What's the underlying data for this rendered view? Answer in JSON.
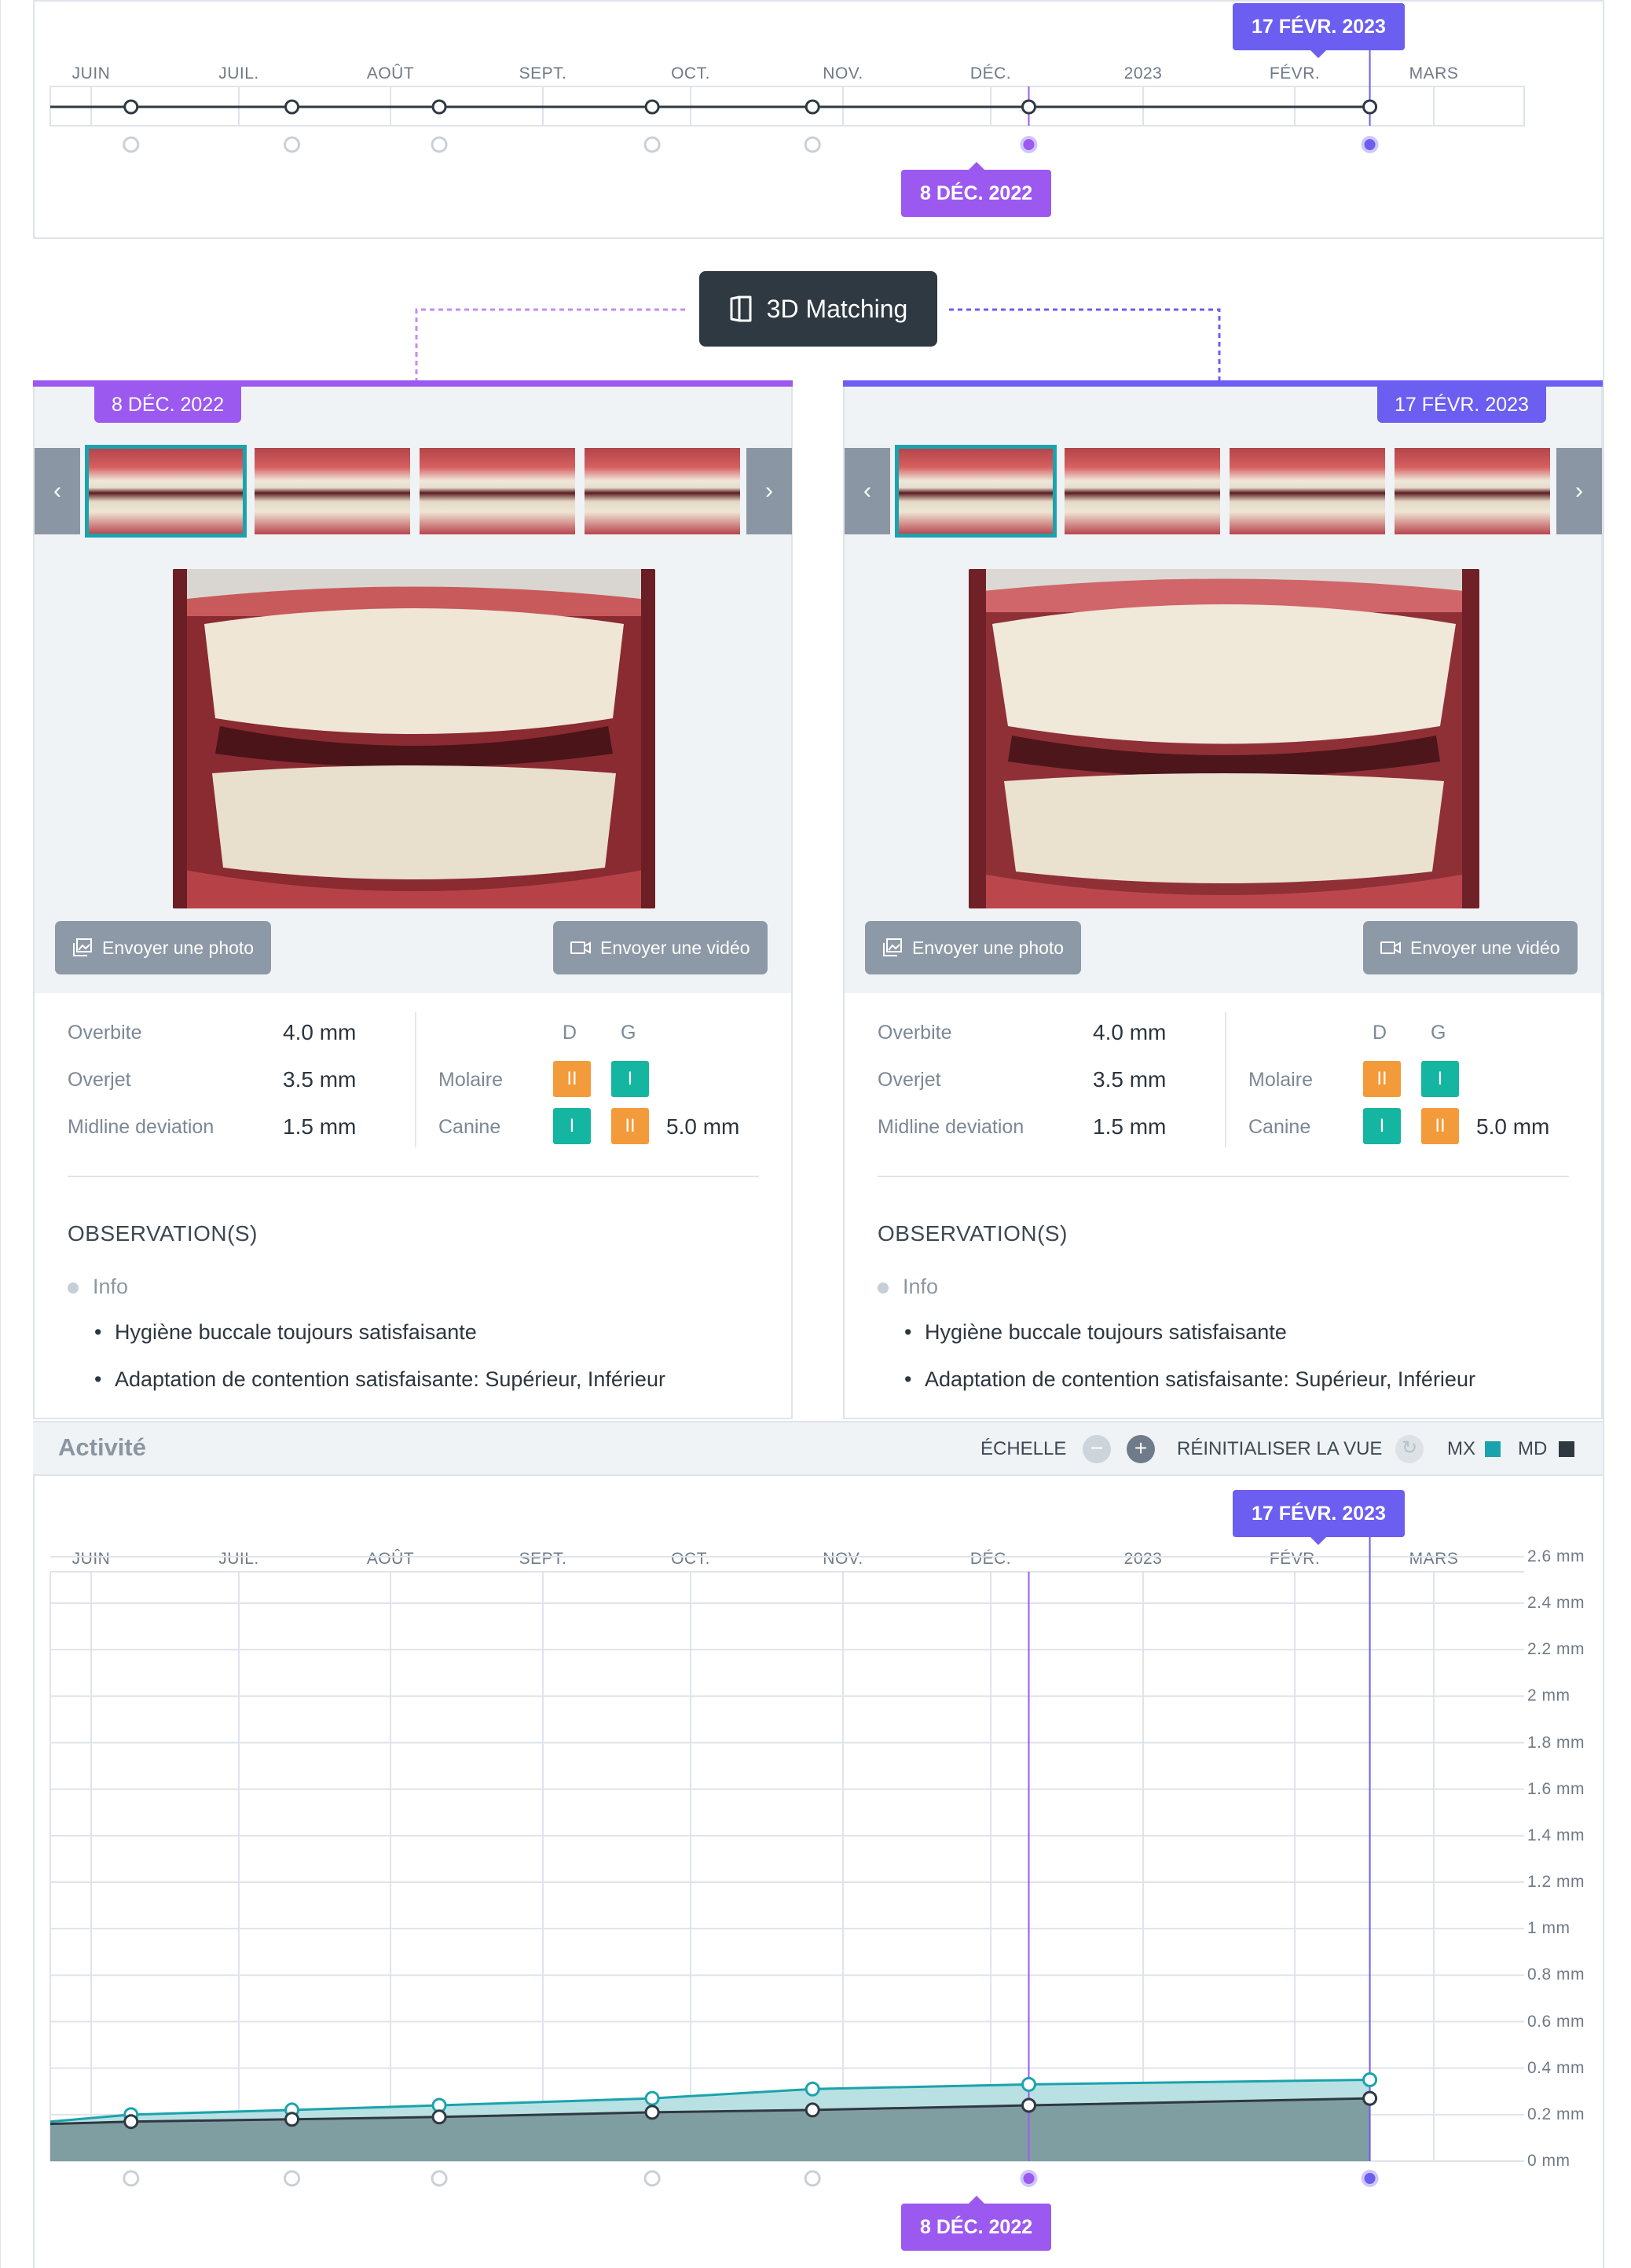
{
  "timeline": {
    "months": [
      "JUIN",
      "JUIL.",
      "AOÛT",
      "SEPT.",
      "OCT.",
      "NOV.",
      "DÉC.",
      "2023",
      "FÉVR.",
      "MARS"
    ],
    "selected_a": "8 DÉC. 2022",
    "selected_b": "17 FÉVR. 2023"
  },
  "matching": {
    "label": "3D Matching"
  },
  "left_panel": {
    "date": "8 DÉC. 2022",
    "send_photo": "Envoyer une photo",
    "send_video": "Envoyer une vidéo",
    "measures": [
      {
        "label": "Overbite",
        "value": "4.0 mm"
      },
      {
        "label": "Overjet",
        "value": "3.5 mm"
      },
      {
        "label": "Midline deviation",
        "value": "1.5 mm"
      }
    ],
    "side_d": "D",
    "side_g": "G",
    "molaire_label": "Molaire",
    "molaire_d": "II",
    "molaire_g": "I",
    "canine_label": "Canine",
    "canine_d": "I",
    "canine_g": "II",
    "canine_value": "5.0 mm",
    "obs_title": "OBSERVATION(S)",
    "obs_category": "Info",
    "obs_items": [
      "Hygiène buccale toujours satisfaisante",
      "Adaptation de contention satisfaisante: Supérieur, Inférieur"
    ]
  },
  "right_panel": {
    "date": "17 FÉVR. 2023",
    "send_photo": "Envoyer une photo",
    "send_video": "Envoyer une vidéo",
    "measures": [
      {
        "label": "Overbite",
        "value": "4.0 mm"
      },
      {
        "label": "Overjet",
        "value": "3.5 mm"
      },
      {
        "label": "Midline deviation",
        "value": "1.5 mm"
      }
    ],
    "side_d": "D",
    "side_g": "G",
    "molaire_label": "Molaire",
    "molaire_d": "II",
    "molaire_g": "I",
    "canine_label": "Canine",
    "canine_d": "I",
    "canine_g": "II",
    "canine_value": "5.0 mm",
    "obs_title": "OBSERVATION(S)",
    "obs_category": "Info",
    "obs_items": [
      "Hygiène buccale toujours satisfaisante",
      "Adaptation de contention satisfaisante: Supérieur, Inférieur"
    ]
  },
  "activity": {
    "title": "Activité",
    "scale_label": "ÉCHELLE",
    "reset_label": "RÉINITIALISER LA VUE",
    "legend_mx": "MX",
    "legend_md": "MD",
    "colors": {
      "mx": "#1ba3ad",
      "md": "#2f3942",
      "accent_a": "#9b59f0",
      "accent_b": "#6b5ef0"
    }
  },
  "chart_data": {
    "type": "area",
    "x_labels": [
      "JUIN",
      "JUIL.",
      "AOÛT",
      "SEPT.",
      "OCT.",
      "NOV.",
      "DÉC.",
      "2023",
      "FÉVR.",
      "MARS"
    ],
    "y_ticks": [
      "0 mm",
      "0.2 mm",
      "0.4 mm",
      "0.6 mm",
      "0.8 mm",
      "1 mm",
      "1.2 mm",
      "1.4 mm",
      "1.6 mm",
      "1.8 mm",
      "2 mm",
      "2.2 mm",
      "2.4 mm",
      "2.6 mm"
    ],
    "ylim": [
      0,
      2.6
    ],
    "x_month_index": [
      1.27,
      2.35,
      3.32,
      4.74,
      5.8,
      7.25,
      9.54
    ],
    "series": [
      {
        "name": "MX",
        "values": [
          0.2,
          0.22,
          0.24,
          0.27,
          0.31,
          0.33,
          0.35
        ]
      },
      {
        "name": "MD",
        "values": [
          0.17,
          0.18,
          0.19,
          0.21,
          0.22,
          0.24,
          0.27
        ]
      }
    ],
    "series_start_value": {
      "MX": 0.17,
      "MD": 0.16
    },
    "selected_points": [
      5,
      6
    ]
  }
}
